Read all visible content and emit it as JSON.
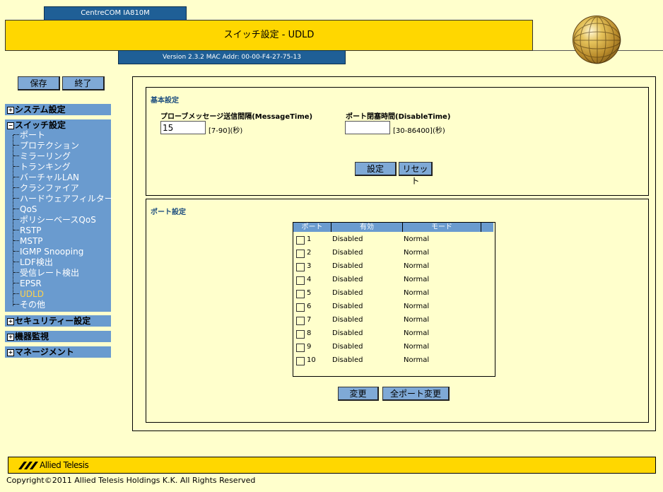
{
  "header": {
    "model": "CentreCOM IA810M",
    "title": "スイッチ設定 - UDLD",
    "version": "Version 2.3.2 MAC Addr: 00-00-F4-27-75-13"
  },
  "toolbar": {
    "save_label": "保存",
    "exit_label": "終了"
  },
  "sidebar": {
    "system": "システム設定",
    "switch": "スイッチ設定",
    "switch_items": [
      "ポート",
      "プロテクション",
      "ミラーリング",
      "トランキング",
      "バーチャルLAN",
      "クラシファイア",
      "ハードウェアフィルター",
      "QoS",
      "ポリシーベースQoS",
      "RSTP",
      "MSTP",
      "IGMP Snooping",
      "LDF検出",
      "受信レート検出",
      "EPSR",
      "UDLD",
      "その他"
    ],
    "active_item": "UDLD",
    "security": "セキュリティー設定",
    "monitor": "機器監視",
    "management": "マネージメント",
    "expand_mark": "+",
    "collapse_mark": "−"
  },
  "basic": {
    "title": "基本設定",
    "message_time_label": "プローブメッセージ送信間隔(MessageTime)",
    "message_time_value": "15",
    "message_time_hint": "[7-90](秒)",
    "disable_time_label": "ポート閉塞時間(DisableTime)",
    "disable_time_value": "",
    "disable_time_hint": "[30-86400](秒)",
    "apply_label": "設定",
    "reset_label": "リセット"
  },
  "port": {
    "title": "ポート設定",
    "columns": [
      "ポート",
      "有効",
      "モード"
    ],
    "rows": [
      {
        "port": "1",
        "enabled": "Disabled",
        "mode": "Normal"
      },
      {
        "port": "2",
        "enabled": "Disabled",
        "mode": "Normal"
      },
      {
        "port": "3",
        "enabled": "Disabled",
        "mode": "Normal"
      },
      {
        "port": "4",
        "enabled": "Disabled",
        "mode": "Normal"
      },
      {
        "port": "5",
        "enabled": "Disabled",
        "mode": "Normal"
      },
      {
        "port": "6",
        "enabled": "Disabled",
        "mode": "Normal"
      },
      {
        "port": "7",
        "enabled": "Disabled",
        "mode": "Normal"
      },
      {
        "port": "8",
        "enabled": "Disabled",
        "mode": "Normal"
      },
      {
        "port": "9",
        "enabled": "Disabled",
        "mode": "Normal"
      },
      {
        "port": "10",
        "enabled": "Disabled",
        "mode": "Normal"
      }
    ],
    "change_label": "変更",
    "change_all_label": "全ポート変更"
  },
  "footer": {
    "logo": "Allied Telesis",
    "copyright": "Copyright©2011 Allied Telesis Holdings K.K. All Rights Reserved"
  },
  "colors": {
    "accent_yellow": "#FFD700",
    "nav_blue": "#6A9BCF",
    "dark_blue": "#1F5F96",
    "background": "#FFFFCC"
  }
}
